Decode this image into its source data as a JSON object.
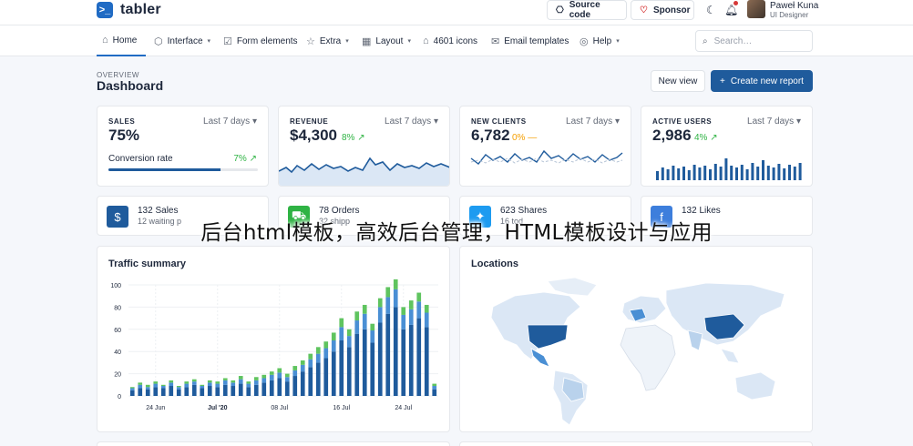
{
  "brand": {
    "name": "tabler",
    "mark": ">_"
  },
  "topbar": {
    "source_code": "Source code",
    "sponsor": "Sponsor",
    "user_name": "Paweł Kuna",
    "user_role": "UI Designer"
  },
  "nav": [
    {
      "label": "Home",
      "icon": "home-icon",
      "active": true
    },
    {
      "label": "Interface",
      "icon": "package-icon",
      "caret": true
    },
    {
      "label": "Form elements",
      "icon": "checkbox-icon"
    },
    {
      "label": "Extra",
      "icon": "star-icon",
      "caret": true
    },
    {
      "label": "Layout",
      "icon": "layout-icon",
      "caret": true
    },
    {
      "label": "4601 icons",
      "icon": "ghost-icon"
    },
    {
      "label": "Email templates",
      "icon": "mail-icon"
    },
    {
      "label": "Help",
      "icon": "lifebuoy-icon",
      "caret": true
    }
  ],
  "search": {
    "placeholder": "Search…"
  },
  "header": {
    "overview": "OVERVIEW",
    "title": "Dashboard",
    "new_view": "New view",
    "create_report": "Create new report"
  },
  "stats": [
    {
      "label": "SALES",
      "range": "Last 7 days",
      "value": "75%",
      "conv_label": "Conversion rate",
      "conv_delta": "7%",
      "progress": 0.75
    },
    {
      "label": "REVENUE",
      "range": "Last 7 days",
      "value": "$4,300",
      "delta": "8%"
    },
    {
      "label": "NEW CLIENTS",
      "range": "Last 7 days",
      "value": "6,782",
      "delta": "0%"
    },
    {
      "label": "ACTIVE USERS",
      "range": "Last 7 days",
      "value": "2,986",
      "delta": "4%"
    }
  ],
  "mini_cards": [
    {
      "title": "132 Sales",
      "sub": "12 waiting p",
      "color": "#1f5b9c",
      "icon": "dollar-icon"
    },
    {
      "title": "78 Orders",
      "sub": "32 shipp",
      "color": "#2fb344",
      "icon": "cart-icon"
    },
    {
      "title": "623 Shares",
      "sub": "16 tod",
      "color": "#1d9bf0",
      "icon": "twitter-icon"
    },
    {
      "title": "132 Likes",
      "sub": "",
      "color": "#3d7edc",
      "icon": "facebook-icon"
    }
  ],
  "panels": {
    "traffic_title": "Traffic summary",
    "locations_title": "Locations"
  },
  "overlay_text": "后台html模板，高效后台管理，HTML模板设计与应用",
  "chart_data": {
    "type": "bar",
    "title": "Traffic summary",
    "ylim": [
      0,
      100
    ],
    "y_ticks": [
      "0",
      "20",
      "40",
      "60",
      "80",
      "100"
    ],
    "x_tick_labels": [
      "24 Jun",
      "Jul '20",
      "08 Jul",
      "16 Jul",
      "24 Jul"
    ],
    "grid": true,
    "series": [
      {
        "color": "#1f5b9c",
        "values": [
          5,
          7,
          6,
          8,
          7,
          9,
          6,
          8,
          10,
          7,
          9,
          8,
          10,
          9,
          11,
          8,
          10,
          12,
          14,
          16,
          13,
          18,
          22,
          26,
          30,
          34,
          40,
          50,
          44,
          56,
          60,
          48,
          66,
          74,
          80,
          60,
          64,
          70,
          62,
          6
        ]
      },
      {
        "color": "#4a8fd4",
        "values": [
          2,
          3,
          2,
          3,
          2,
          3,
          2,
          3,
          3,
          2,
          3,
          3,
          4,
          3,
          4,
          3,
          4,
          4,
          5,
          5,
          4,
          5,
          6,
          7,
          8,
          9,
          10,
          12,
          10,
          12,
          14,
          11,
          14,
          15,
          16,
          13,
          14,
          15,
          13,
          3
        ]
      },
      {
        "color": "#5fc45f",
        "values": [
          1,
          2,
          2,
          2,
          1,
          2,
          1,
          2,
          2,
          1,
          2,
          2,
          2,
          2,
          3,
          2,
          3,
          3,
          3,
          4,
          3,
          4,
          4,
          5,
          6,
          6,
          7,
          8,
          6,
          8,
          8,
          6,
          8,
          9,
          9,
          7,
          8,
          8,
          7,
          2
        ]
      }
    ]
  },
  "colors": {
    "accent": "#206bc4",
    "dark_blue": "#1f5b9c",
    "green": "#2fb344",
    "warn": "#f59f00"
  }
}
